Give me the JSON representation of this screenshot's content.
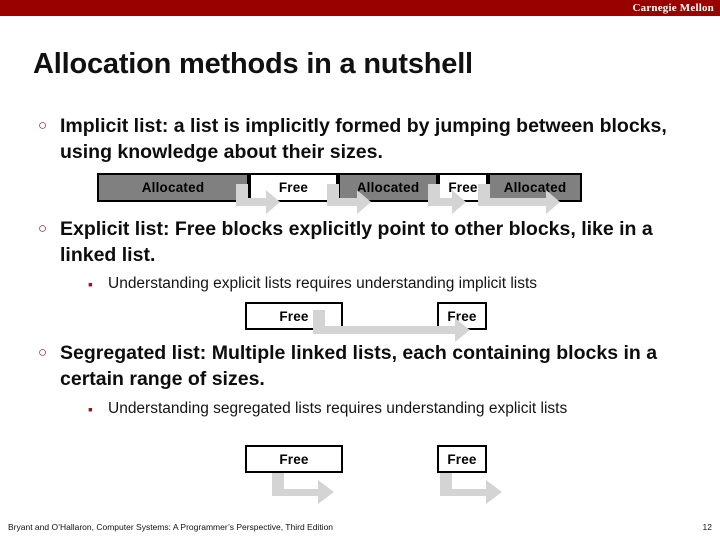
{
  "header": {
    "brand": "Carnegie Mellon",
    "brand_color": "#990000"
  },
  "title": "Allocation methods in a nutshell",
  "bullets": [
    {
      "marker": "○",
      "text": "Implicit list: a list is implicitly formed by jumping between blocks, using knowledge about their sizes."
    },
    {
      "marker": "○",
      "text": "Explicit list: Free blocks explicitly point to other blocks, like in a linked list."
    },
    {
      "marker": "○",
      "text": "Segregated list: Multiple linked lists, each containing blocks in a certain range of sizes."
    }
  ],
  "subbullets": [
    {
      "marker": "▪",
      "text": "Understanding explicit lists requires understanding implicit lists"
    },
    {
      "marker": "▪",
      "text": "Understanding segregated lists requires understanding explicit lists"
    }
  ],
  "diagrams": {
    "implicit": {
      "blocks": [
        {
          "label": "Allocated",
          "kind": "allocated"
        },
        {
          "label": "Free",
          "kind": "free"
        },
        {
          "label": "Allocated",
          "kind": "allocated"
        },
        {
          "label": "Free",
          "kind": "free"
        },
        {
          "label": "Allocated",
          "kind": "allocated"
        }
      ]
    },
    "explicit": {
      "blocks": [
        {
          "label": "Free",
          "kind": "free"
        },
        {
          "label": "Free",
          "kind": "free"
        }
      ]
    },
    "segregated": {
      "blocks": [
        {
          "label": "Free",
          "kind": "free"
        },
        {
          "label": "Free",
          "kind": "free"
        }
      ]
    },
    "arrow_color": "#d4d4d4",
    "allocated_fill": "#808080",
    "free_fill": "#ffffff",
    "border_color": "#000000"
  },
  "footer": {
    "citation": "Bryant and O’Hallaron, Computer Systems: A Programmer’s Perspective, Third Edition",
    "page": "12"
  }
}
